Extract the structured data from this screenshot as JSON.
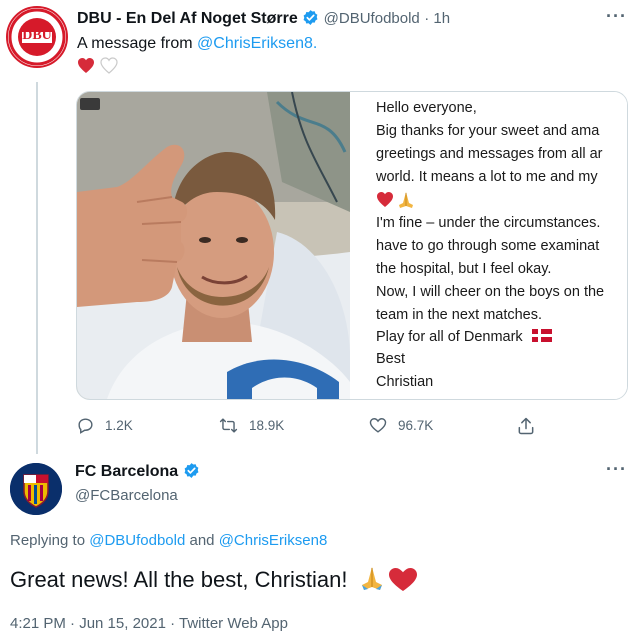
{
  "tweet1": {
    "display_name": "DBU - En Del Af Noget Større",
    "handle": "@DBUfodbold",
    "time": "· 1h",
    "text_prefix": "A message from ",
    "mention": "@ChrisEriksen8.",
    "avatar_text": "DBU",
    "card_note_lines": [
      "Hello everyone,",
      "Big thanks for your sweet and ama",
      "greetings and messages from all ar",
      "world. It means a lot to me and my",
      "I'm fine – under the circumstances.",
      "have to go through some examinat",
      "the hospital, but I feel okay.",
      "Now, I will cheer on the boys on the",
      "team in the next matches.",
      "Play for all of Denmark",
      "Best",
      "Christian"
    ],
    "actions": {
      "replies": "1.2K",
      "retweets": "18.9K",
      "likes": "96.7K"
    }
  },
  "tweet2": {
    "display_name": "FC Barcelona",
    "handle": "@FCBarcelona",
    "replying_label": "Replying to ",
    "replying_user1": "@DBUfodbold",
    "replying_and": " and ",
    "replying_user2": "@ChrisEriksen8",
    "text": "Great news! All the best, Christian!",
    "timestamp": "4:21 PM · Jun 15, 2021 · Twitter Web App",
    "avatar_text": "FCB"
  },
  "colors": {
    "accent": "#1d9bf0",
    "heart_red": "#d62b3a",
    "dbu_red": "#d61a2a",
    "fcb_blue": "#0a2f6b",
    "muted": "#536471"
  },
  "icons": [
    "more-icon",
    "verified-icon",
    "reply-icon",
    "retweet-icon",
    "like-icon",
    "share-icon",
    "heart-emoji",
    "white-heart-emoji",
    "pray-emoji",
    "denmark-flag-emoji"
  ]
}
